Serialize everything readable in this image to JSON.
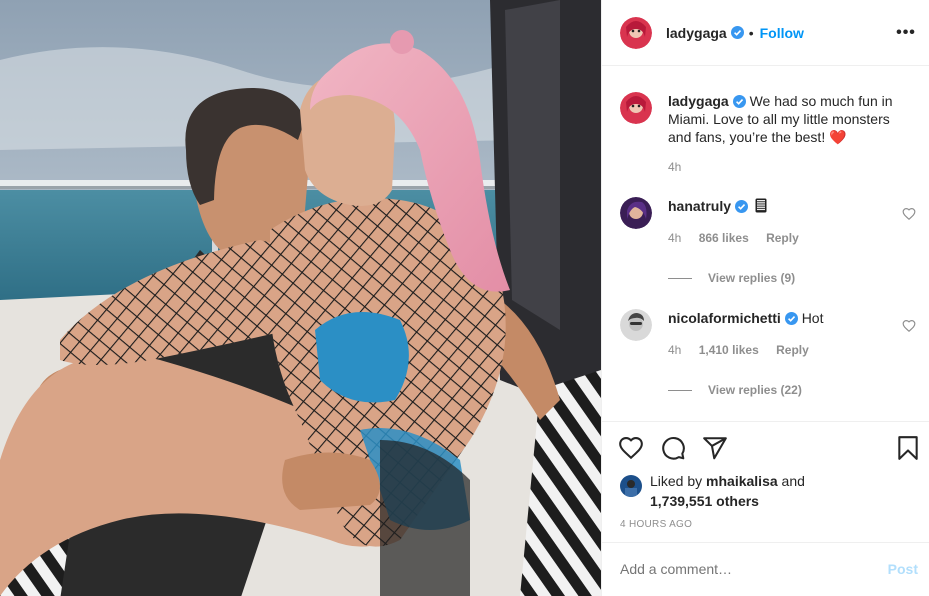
{
  "header": {
    "username": "ladygaga",
    "separator": "•",
    "follow_label": "Follow",
    "more_label": "•••"
  },
  "caption": {
    "username": "ladygaga",
    "text": "We had so much fun in Miami. Love to all my little monsters and fans, you’re the best! ❤️",
    "time": "4h"
  },
  "comments": [
    {
      "username": "hanatruly",
      "text": "",
      "text_icon": "mobile-phone-emoji",
      "time": "4h",
      "likes": "866 likes",
      "reply_label": "Reply",
      "view_replies": "View replies (9)"
    },
    {
      "username": "nicolaformichetti",
      "text": "Hot",
      "time": "4h",
      "likes": "1,410 likes",
      "reply_label": "Reply",
      "view_replies": "View replies (22)"
    }
  ],
  "actions": {
    "icons": [
      "heart-icon",
      "comment-icon",
      "share-icon",
      "bookmark-icon"
    ]
  },
  "likes": {
    "prefix": "Liked by",
    "user": "mhaikalisa",
    "and": "and",
    "count": "1,739,551 others"
  },
  "timestamp": "4 HOURS AGO",
  "add_comment": {
    "placeholder": "Add a comment…",
    "post_label": "Post"
  },
  "colors": {
    "accent": "#0095f6",
    "post_disabled": "#b2dffc",
    "muted": "#8e8e8e",
    "text": "#262626",
    "verified": "#3897f0",
    "heart_red": "#e0245e"
  }
}
